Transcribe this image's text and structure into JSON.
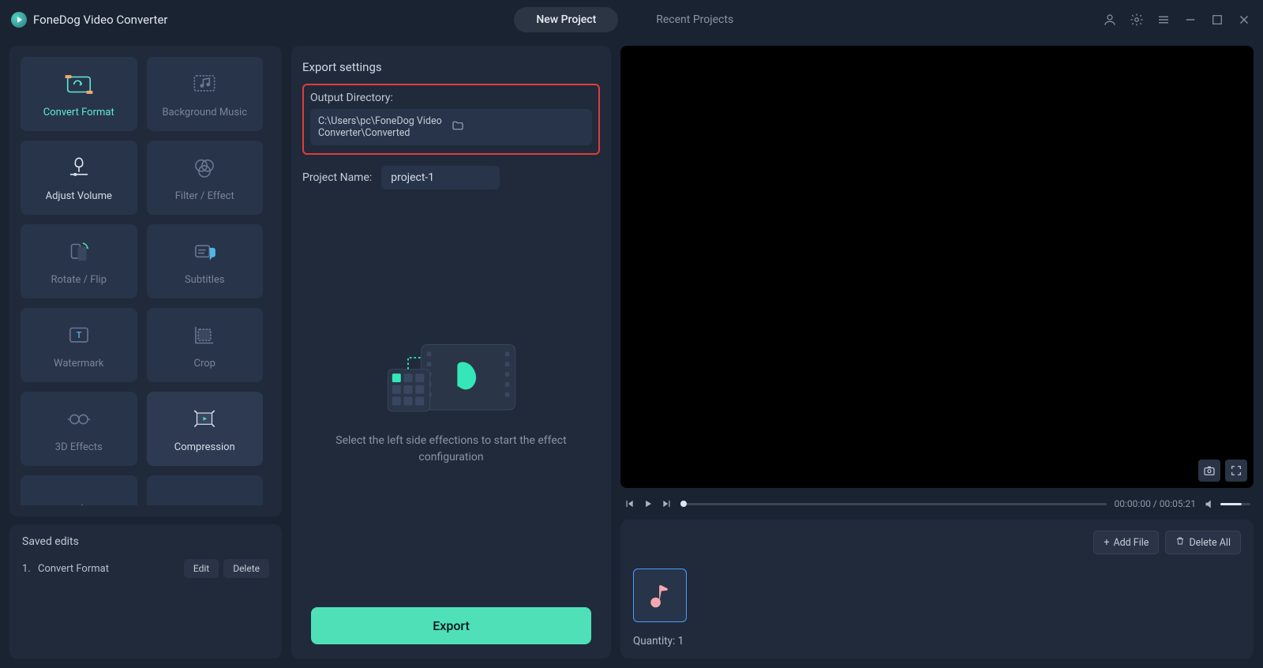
{
  "app_title": "FoneDog Video Converter",
  "tabs": {
    "new_project": "New Project",
    "recent_projects": "Recent Projects"
  },
  "effects": [
    {
      "label": "Convert Format",
      "state": "active"
    },
    {
      "label": "Background Music",
      "state": "dim"
    },
    {
      "label": "Adjust Volume",
      "state": "hi"
    },
    {
      "label": "Filter / Effect",
      "state": "dim"
    },
    {
      "label": "Rotate / Flip",
      "state": "dim"
    },
    {
      "label": "Subtitles",
      "state": "dim"
    },
    {
      "label": "Watermark",
      "state": "dim"
    },
    {
      "label": "Crop",
      "state": "dim"
    },
    {
      "label": "3D Effects",
      "state": "dim"
    },
    {
      "label": "Compression",
      "state": "light"
    }
  ],
  "saved": {
    "title": "Saved edits",
    "items": [
      {
        "index": "1.",
        "name": "Convert Format"
      }
    ],
    "edit": "Edit",
    "delete": "Delete"
  },
  "export": {
    "section_title": "Export settings",
    "output_dir_label": "Output Directory:",
    "output_dir_value": "C:\\Users\\pc\\FoneDog Video Converter\\Converted",
    "project_name_label": "Project Name:",
    "project_name_value": "project-1",
    "placeholder_text": "Select the left side effections to start the effect configuration",
    "export_btn": "Export"
  },
  "player": {
    "current": "00:00:00",
    "total": "00:05:21"
  },
  "files": {
    "add": "Add File",
    "delete_all": "Delete All",
    "quantity_label": "Quantity:",
    "quantity": "1"
  }
}
